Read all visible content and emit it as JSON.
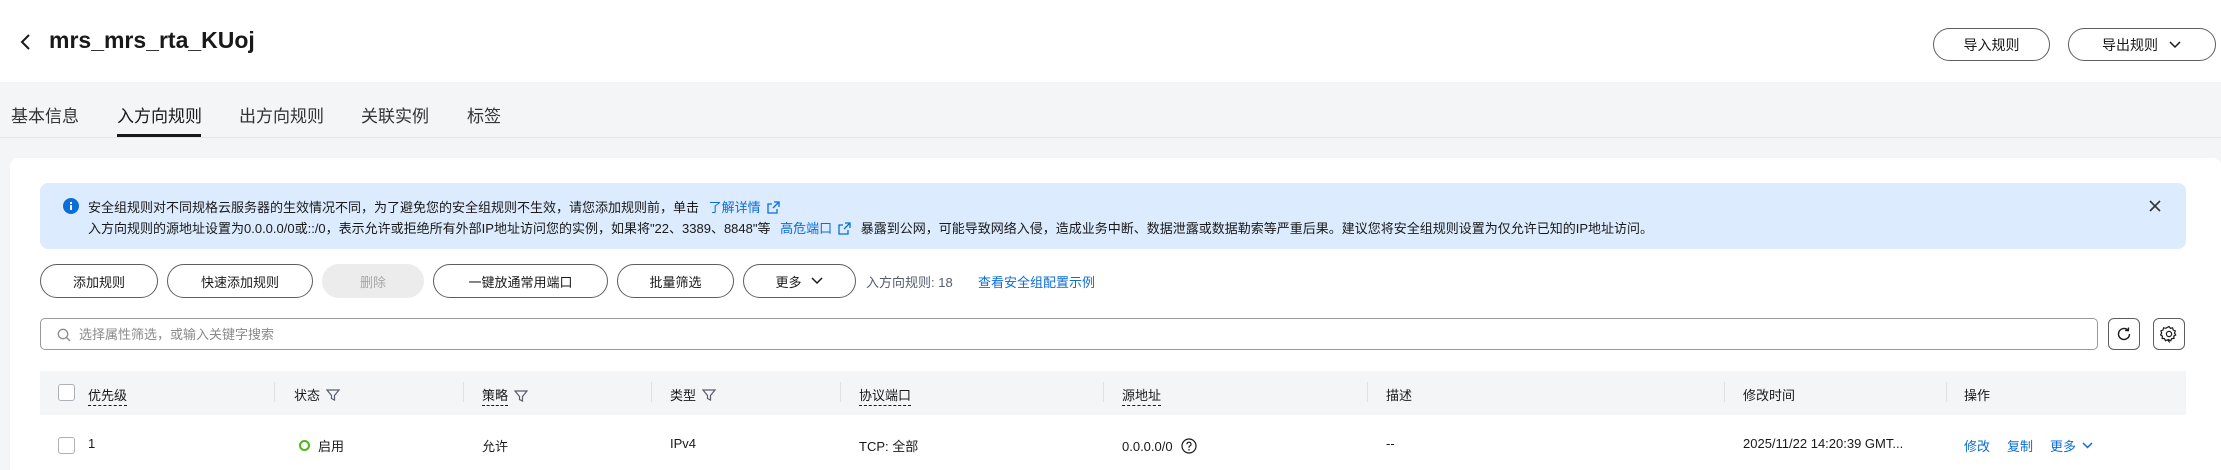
{
  "header": {
    "title": "mrs_mrs_rta_KUoj",
    "import_label": "导入规则",
    "export_label": "导出规则"
  },
  "tabs": [
    {
      "label": "基本信息"
    },
    {
      "label": "入方向规则",
      "active": true
    },
    {
      "label": "出方向规则"
    },
    {
      "label": "关联实例"
    },
    {
      "label": "标签"
    }
  ],
  "alert": {
    "line1": "安全组规则对不同规格云服务器的生效情况不同，为了避免您的安全组规则不生效，请您添加规则前，单击",
    "line1_link": "了解详情",
    "line2_a": "入方向规则的源地址设置为0.0.0.0/0或::/0，表示允许或拒绝所有外部IP地址访问您的实例，如果将\"22、3389、8848\"等",
    "line2_link": "高危端口",
    "line2_b": "暴露到公网，可能导致网络入侵，造成业务中断、数据泄露或数据勒索等严重后果。建议您将安全组规则设置为仅允许已知的IP地址访问。"
  },
  "toolbar": {
    "add_rule": "添加规则",
    "quick_add": "快速添加规则",
    "delete": "删除",
    "open_common_ports": "一键放通常用端口",
    "batch_filter": "批量筛选",
    "more": "更多",
    "rule_count_label": "入方向规则: 18",
    "example_link": "查看安全组配置示例"
  },
  "search": {
    "placeholder": "选择属性筛选，或输入关键字搜索"
  },
  "table": {
    "headers": {
      "priority": "优先级",
      "status": "状态",
      "policy": "策略",
      "type": "类型",
      "protocol_port": "协议端口",
      "source": "源地址",
      "description": "描述",
      "modified": "修改时间",
      "actions": "操作"
    },
    "rows": [
      {
        "priority": "1",
        "status": "启用",
        "policy": "允许",
        "type": "IPv4",
        "protocol_port": "TCP: 全部",
        "source": "0.0.0.0/0",
        "description": "--",
        "modified": "2025/11/22 14:20:39 GMT...",
        "action_modify": "修改",
        "action_copy": "复制",
        "action_more": "更多"
      }
    ]
  },
  "colors": {
    "link": "#0a6dd9",
    "alert_bg": "#dcebfd",
    "status_enabled": "#50b41b"
  }
}
